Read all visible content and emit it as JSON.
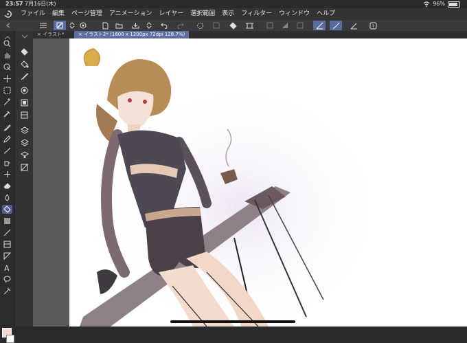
{
  "status": {
    "time": "23:57",
    "date": "7月16日(木)",
    "battery": "96%"
  },
  "menu": {
    "items": [
      "ファイル",
      "編集",
      "ページ管理",
      "アニメーション",
      "レイヤー",
      "選択範囲",
      "表示",
      "フィルター",
      "ウィンドウ",
      "ヘルプ"
    ]
  },
  "tabs": [
    {
      "label": "イラスト*"
    },
    {
      "label": "イラスト2* (1600 x 1200px 72dpi 128.7%)"
    }
  ],
  "colors": {
    "accent": "#5b6d9c",
    "foreground_swatch": "#f3d8cf"
  }
}
